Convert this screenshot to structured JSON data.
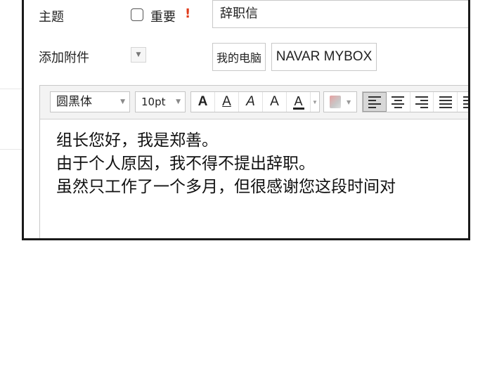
{
  "form": {
    "subject_label": "主题",
    "important_label": "重要",
    "important_mark": "!",
    "subject_value": "辞职信",
    "attachment_label": "添加附件",
    "attach_dropdown_arrow": "▼",
    "my_pc_button": "我的电脑",
    "mybox_button": "NAVAR MYBOX"
  },
  "toolbar": {
    "font_family": "圆黑体",
    "font_size": "10pt",
    "select_arrow": "▼",
    "bold": "A",
    "underline": "A",
    "italic": "A",
    "strike": "A",
    "text_color": "A",
    "small_arrow": "▼"
  },
  "body": {
    "lines": [
      "组长您好，我是郑善。",
      "由于个人原因，我不得不提出辞职。",
      "虽然只工作了一个多月，但很感谢您这段时间对"
    ]
  },
  "colors": {
    "important_mark": "#e03a1a",
    "frame_border": "#1a1a1a",
    "toolbar_bg": "#f3f3f3"
  }
}
